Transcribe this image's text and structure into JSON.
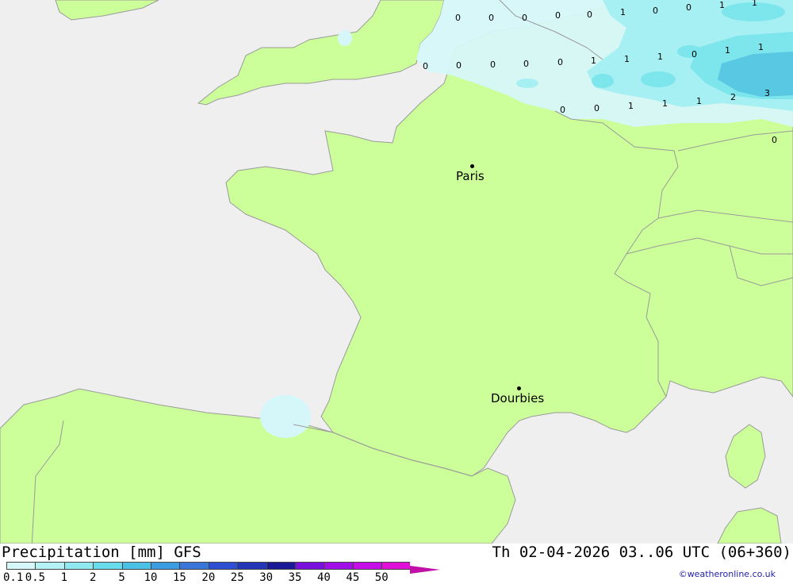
{
  "colors": {
    "sea": "#efefef",
    "land": "#ccff99",
    "border": "#9a9a9a",
    "precip_light": "#d6f7f9",
    "precip_mid": "#a6f0f3",
    "precip_heavy": "#7de6ec",
    "precip_blue": "#58c8e3"
  },
  "cities": [
    {
      "id": "paris",
      "name": "Paris"
    },
    {
      "id": "dourbies",
      "name": "Dourbies"
    }
  ],
  "grid_values": [
    "0",
    "0",
    "0",
    "0",
    "0",
    "1",
    "0",
    "0",
    "1",
    "1",
    "0",
    "0",
    "0",
    "0",
    "0",
    "1",
    "1",
    "1",
    "0",
    "1",
    "1",
    "0",
    "0",
    "1",
    "1",
    "1",
    "2",
    "3",
    "0"
  ],
  "footer": {
    "title": "Precipitation [mm] GFS",
    "time": "Th 02-04-2026 03..06 UTC (06+360)",
    "credit": "©weatheronline.co.uk"
  },
  "legend": {
    "colors": [
      "#d6f7f9",
      "#b3f1f5",
      "#8fe9ef",
      "#69dcec",
      "#4cc1e6",
      "#3c9ce0",
      "#3a75da",
      "#2f4fd2",
      "#2535b8",
      "#1a1a96",
      "#7a10e0",
      "#a00ee8",
      "#c80ee8",
      "#e010d8",
      "#c010a8"
    ],
    "labels": [
      "0.1",
      "0.5",
      "1",
      "2",
      "5",
      "10",
      "15",
      "20",
      "25",
      "30",
      "35",
      "40",
      "45",
      "50"
    ]
  }
}
